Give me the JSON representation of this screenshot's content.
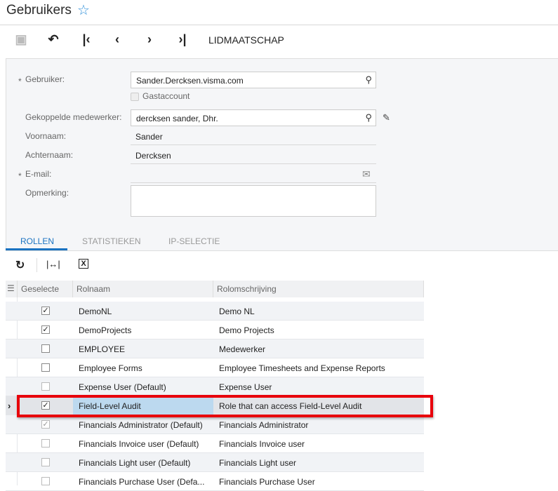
{
  "header": {
    "title": "Gebruikers",
    "favorite_icon": "star-outline-icon",
    "accent": "#2d8fd9"
  },
  "toolbar": {
    "icons": [
      "save-icon",
      "undo-icon",
      "first-icon",
      "previous-icon",
      "next-icon",
      "last-icon"
    ],
    "membership_label": "LIDMAATSCHAP"
  },
  "form": {
    "user": {
      "label": "Gebruiker:",
      "value": "Sander.Dercksen.visma.com"
    },
    "guest": {
      "label": "Gastaccount",
      "checked": false
    },
    "employee": {
      "label": "Gekoppelde medewerker:",
      "value": "dercksen sander, Dhr."
    },
    "first_name": {
      "label": "Voornaam:",
      "value": "Sander"
    },
    "last_name": {
      "label": "Achternaam:",
      "value": "Dercksen"
    },
    "email": {
      "label": "E-mail:",
      "value": ""
    },
    "remark": {
      "label": "Opmerking:",
      "value": ""
    },
    "required_mark": "*"
  },
  "tabs": [
    {
      "label": "ROLLEN",
      "active": true
    },
    {
      "label": "STATISTIEKEN"
    },
    {
      "label": "IP-SELECTIE"
    }
  ],
  "grid": {
    "columns": [
      "Geselecte",
      "Rolnaam",
      "Rolomschrijving"
    ],
    "rows": [
      {
        "name": "DemoNL",
        "desc": "Demo NL",
        "checked": true
      },
      {
        "name": "DemoProjects",
        "desc": "Demo Projects",
        "checked": true
      },
      {
        "name": "EMPLOYEE",
        "desc": "Medewerker",
        "checked": false
      },
      {
        "name": "Employee Forms",
        "desc": "Employee Timesheets and Expense Reports",
        "checked": false
      },
      {
        "name": "Expense User (Default)",
        "desc": "Expense User",
        "checked": false,
        "disabled": true
      },
      {
        "name": "Field-Level Audit",
        "desc": "Role that can access Field-Level Audit",
        "checked": true,
        "selected": true
      },
      {
        "name": "Financials Administrator (Default)",
        "desc": "Financials Administrator",
        "checked": true,
        "disabled": true
      },
      {
        "name": "Financials Invoice user (Default)",
        "desc": "Financials Invoice user",
        "checked": false,
        "disabled": true
      },
      {
        "name": "Financials Light user (Default)",
        "desc": "Financials Light user",
        "checked": false,
        "disabled": true
      },
      {
        "name": "Financials Purchase User (Defa...",
        "desc": "Financials Purchase User",
        "checked": false,
        "disabled": true
      }
    ],
    "highlight_color": "#e8000b"
  }
}
